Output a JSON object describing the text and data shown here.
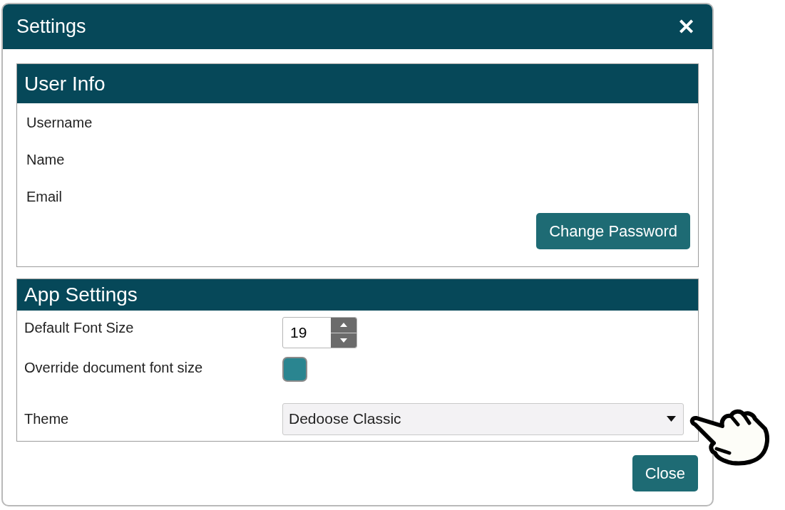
{
  "dialog": {
    "title": "Settings",
    "close_icon": "✕"
  },
  "user_info": {
    "title": "User Info",
    "fields": [
      "Username",
      "Name",
      "Email"
    ],
    "button": "Change Password"
  },
  "app_settings": {
    "title": "App Settings",
    "rows": [
      {
        "kind": "number",
        "label": "Default Font Size",
        "value": "19"
      },
      {
        "kind": "checkbox",
        "label": "Override document font size",
        "checked": true
      },
      {
        "kind": "select",
        "label": "Theme",
        "value": "Dedoose Classic"
      }
    ]
  },
  "footer": {
    "button": "Close"
  }
}
